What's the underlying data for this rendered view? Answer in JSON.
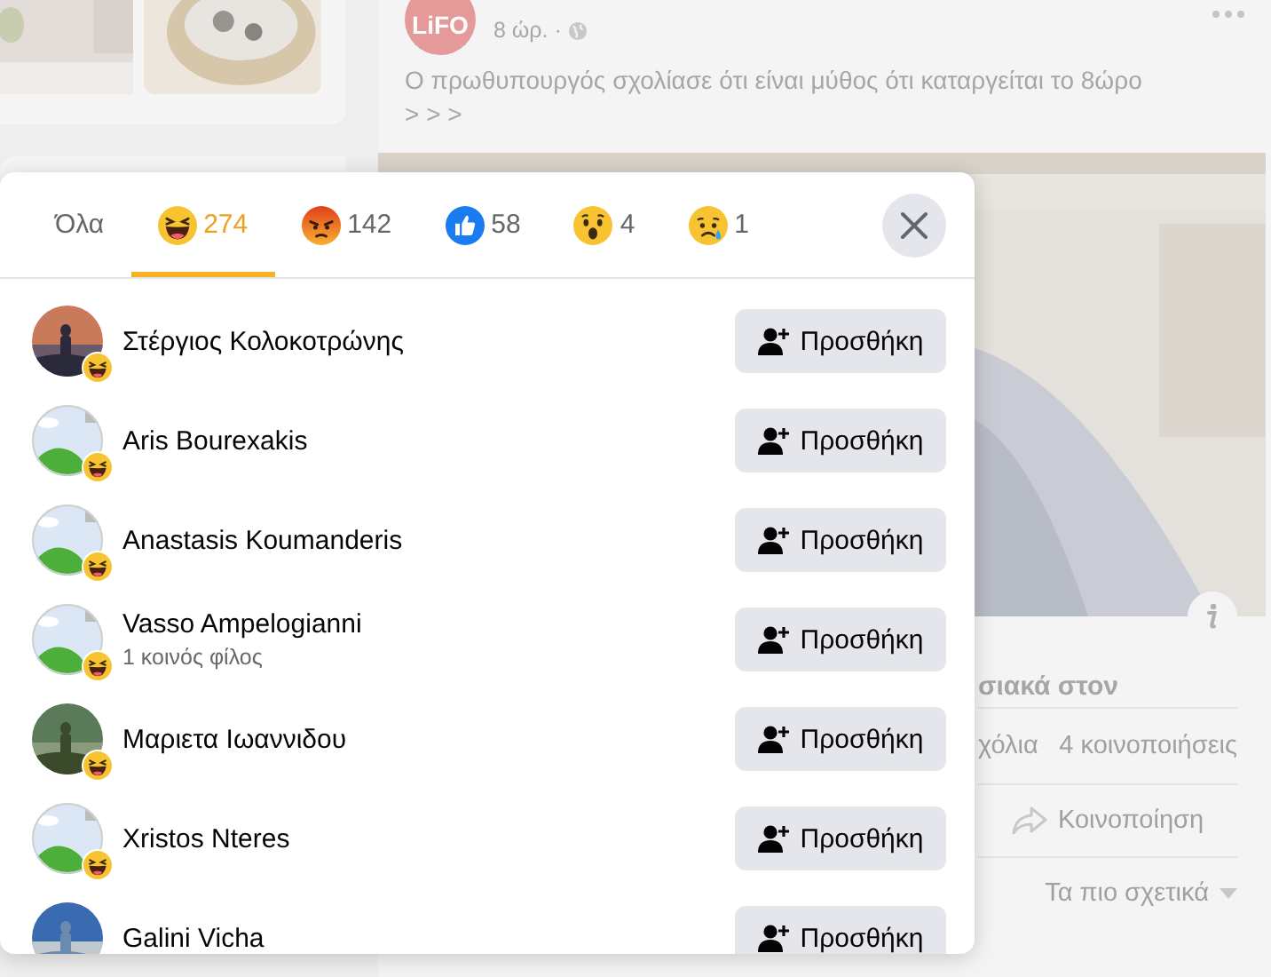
{
  "page": {
    "post": {
      "logo": "LiFO",
      "time": "8 ώρ. ·",
      "text": "Ο πρωθυπουργός σχολίασε ότι είναι μύθος ότι καταργείται το 8ώρο",
      "more": "> > >",
      "headline_part": "σιακά στον",
      "comments_part": "χόλια",
      "shares": "4 κοινοποιήσεις",
      "share_button": "Κοινοποίηση",
      "sort": "Τα πιο σχετικά"
    }
  },
  "dialog": {
    "tabs": [
      {
        "kind": "all",
        "label": "Όλα",
        "selected": false
      },
      {
        "kind": "haha",
        "count": "274",
        "selected": true
      },
      {
        "kind": "angry",
        "count": "142",
        "selected": false
      },
      {
        "kind": "like",
        "count": "58",
        "selected": false
      },
      {
        "kind": "wow",
        "count": "4",
        "selected": false
      },
      {
        "kind": "sad",
        "count": "1",
        "selected": false
      }
    ],
    "people": [
      {
        "name": "Στέργιος Κολοκοτρώνης",
        "reaction": {
          "kind": "haha"
        },
        "button": "Προσθήκη"
      },
      {
        "name": "Aris Bourexakis",
        "avatar": {
          "kind": "default"
        },
        "reaction": {
          "kind": "haha"
        },
        "button": "Προσθήκη"
      },
      {
        "name": "Anastasis Koumanderis",
        "avatar": {
          "kind": "default"
        },
        "reaction": {
          "kind": "haha"
        },
        "button": "Προσθήκη"
      },
      {
        "name": "Vasso Ampelogianni",
        "subtitle": "1 κοινός φίλος",
        "avatar": {
          "kind": "default"
        },
        "reaction": {
          "kind": "haha"
        },
        "button": "Προσθήκη"
      },
      {
        "name": "Μαριετα Ιωαννιδου",
        "reaction": {
          "kind": "haha"
        },
        "button": "Προσθήκη"
      },
      {
        "name": "Xristos Nteres",
        "avatar": {
          "kind": "default"
        },
        "reaction": {
          "kind": "haha"
        },
        "button": "Προσθήκη"
      },
      {
        "name": "Galini Vicha",
        "button": "Προσθήκη"
      }
    ]
  }
}
